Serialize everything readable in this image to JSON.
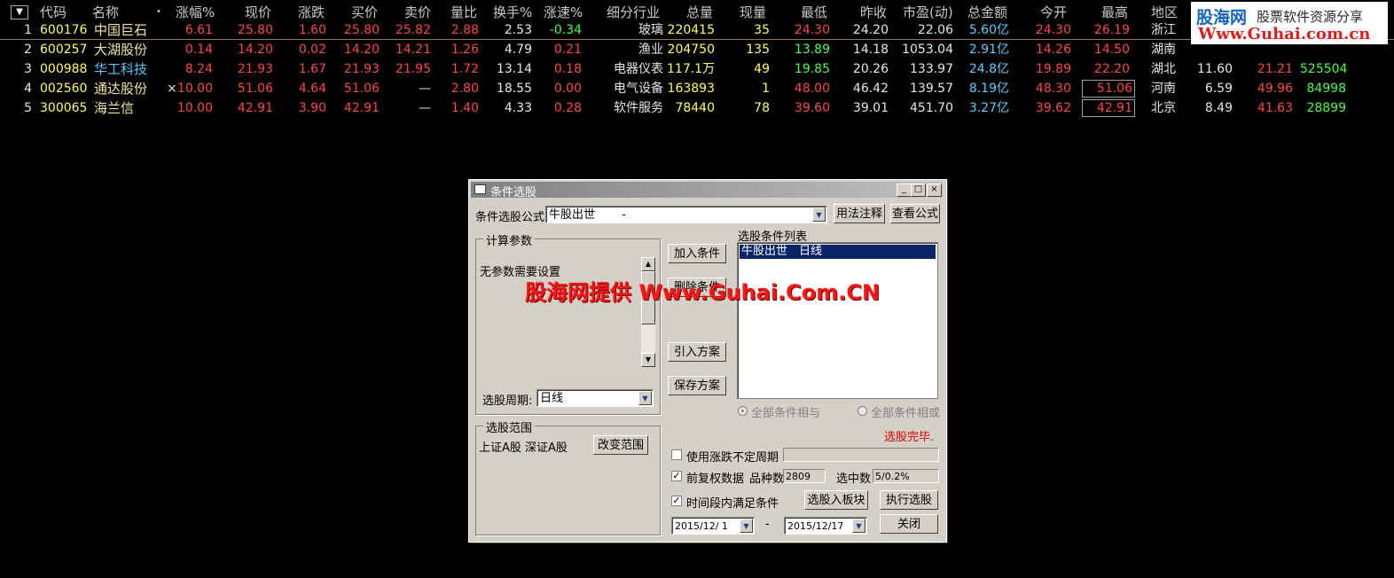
{
  "table": {
    "menu_glyph": "▼",
    "headers": [
      "代码",
      "名称",
      "•",
      "涨幅%",
      "现价",
      "涨跌",
      "买价",
      "卖价",
      "量比",
      "换手%",
      "涨速%",
      "细分行业",
      "总量",
      "现量",
      "最低",
      "昨收",
      "市盈(动)",
      "总金额",
      "今开",
      "最高",
      "地区"
    ],
    "rows": [
      {
        "no": "1",
        "code": "600176",
        "name": "中国巨石",
        "mark": "",
        "pct": "6.61",
        "price": "25.80",
        "chg": "1.60",
        "bid": "25.80",
        "ask": "25.82",
        "vr": "2.88",
        "turn": "2.53",
        "speed": "-0.34",
        "ind": "玻璃",
        "vol": "220415",
        "cur": "35",
        "low": "24.30",
        "prev": "24.20",
        "pe": "22.06",
        "amt": "5.60亿",
        "open": "24.30",
        "high": "26.19",
        "region": "浙江",
        "x1": "",
        "x2": "",
        "x3": ""
      },
      {
        "no": "2",
        "code": "600257",
        "name": "大湖股份",
        "mark": "",
        "pct": "0.14",
        "price": "14.20",
        "chg": "0.02",
        "bid": "14.20",
        "ask": "14.21",
        "vr": "1.26",
        "turn": "4.79",
        "speed": "0.21",
        "ind": "渔业",
        "vol": "204750",
        "cur": "135",
        "low": "13.89",
        "prev": "14.18",
        "pe": "1053.04",
        "amt": "2.91亿",
        "open": "14.26",
        "high": "14.50",
        "region": "湖南",
        "x1": "",
        "x2": "",
        "x3": ""
      },
      {
        "no": "3",
        "code": "000988",
        "name": "华工科技",
        "mark": "",
        "pct": "8.24",
        "price": "21.93",
        "chg": "1.67",
        "bid": "21.93",
        "ask": "21.95",
        "vr": "1.72",
        "turn": "13.14",
        "speed": "0.18",
        "ind": "电器仪表",
        "vol": "117.1万",
        "cur": "49",
        "low": "19.85",
        "prev": "20.26",
        "pe": "133.97",
        "amt": "24.8亿",
        "open": "19.89",
        "high": "22.20",
        "region": "湖北",
        "x1": "11.60",
        "x2": "21.21",
        "x3": "525504"
      },
      {
        "no": "4",
        "code": "002560",
        "name": "通达股份",
        "mark": "×",
        "pct": "10.00",
        "price": "51.06",
        "chg": "4.64",
        "bid": "51.06",
        "ask": "—",
        "vr": "2.80",
        "turn": "18.55",
        "speed": "0.00",
        "ind": "电气设备",
        "vol": "163893",
        "cur": "1",
        "low": "48.00",
        "prev": "46.42",
        "pe": "139.57",
        "amt": "8.19亿",
        "open": "48.30",
        "high": "51.06",
        "region": "河南",
        "x1": "6.59",
        "x2": "49.96",
        "x3": "84998"
      },
      {
        "no": "5",
        "code": "300065",
        "name": "海兰信",
        "mark": "",
        "pct": "10.00",
        "price": "42.91",
        "chg": "3.90",
        "bid": "42.91",
        "ask": "—",
        "vr": "1.40",
        "turn": "4.33",
        "speed": "0.28",
        "ind": "软件服务",
        "vol": "78440",
        "cur": "78",
        "low": "39.60",
        "prev": "39.01",
        "pe": "451.70",
        "amt": "3.27亿",
        "open": "39.62",
        "high": "42.91",
        "region": "北京",
        "x1": "8.49",
        "x2": "41.63",
        "x3": "28899"
      }
    ]
  },
  "logo": {
    "brand": "股海网",
    "tagline": "股票软件资源分享",
    "url": "Www.Guhai.com.cn"
  },
  "dialog": {
    "title": "条件选股",
    "formula_label": "条件选股公式",
    "formula_value": "牛股出世　　 -",
    "btn_usage": "用法注释",
    "btn_view": "查看公式",
    "calc_group": "计算参数",
    "calc_text": "无参数需要设置",
    "period_label": "选股周期:",
    "period_value": "日线",
    "btn_add": "加入条件",
    "btn_delete": "删除条件",
    "btn_import": "引入方案",
    "btn_save": "保存方案",
    "list_label": "选股条件列表",
    "list_items": [
      "牛股出世　日线"
    ],
    "radio_and": "全部条件相与",
    "radio_or": "全部条件相或",
    "status": "选股完毕.",
    "range_group": "选股范围",
    "range_text": "上证A股  深证A股",
    "btn_change_range": "改变范围",
    "chk_variable_period": "使用涨跌不定周期",
    "chk_forward_adjust": "前复权数据",
    "count_label": "品种数",
    "count_value": "2809",
    "selected_label": "选中数",
    "selected_value": "5/0.2%",
    "chk_time_period": "时间段内满足条件",
    "btn_to_block": "选股入板块",
    "btn_execute": "执行选股",
    "date_from": "2015/12/ 1",
    "date_sep": "-",
    "date_to": "2015/12/17",
    "btn_close": "关闭"
  },
  "watermark": "股海网提供 Www.Guhai.Com.CN",
  "colors": {
    "up": "#ff4444",
    "down": "#44ff44",
    "volume": "#ffff55",
    "amount": "#55d0ff",
    "selection": "#0a246a",
    "status": "#e00000"
  }
}
